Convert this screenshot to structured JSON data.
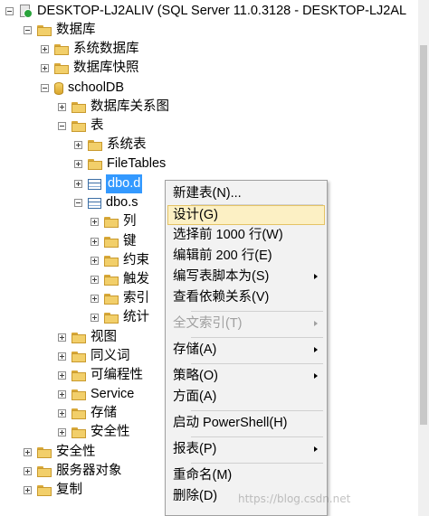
{
  "tree": {
    "server": "DESKTOP-LJ2ALIV (SQL Server 11.0.3128 - DESKTOP-LJ2AL",
    "databases": "数据库",
    "system_databases": "系统数据库",
    "db_snapshots": "数据库快照",
    "schooldb": "schoolDB",
    "db_diagrams": "数据库关系图",
    "tables": "表",
    "system_tables": "系统表",
    "filetables": "FileTables",
    "dbo_table1": "dbo.d",
    "dbo_table2": "dbo.s",
    "columns": "列",
    "keys": "键",
    "constraints": "约束",
    "triggers": "触发",
    "indexes": "索引",
    "statistics": "统计",
    "views": "视图",
    "synonyms": "同义词",
    "programmability": "可编程性",
    "service_broker": "Service",
    "storage": "存储",
    "security_db": "安全性",
    "security": "安全性",
    "server_objects": "服务器对象",
    "replication": "复制"
  },
  "context_menu": {
    "new_table": "新建表(N)...",
    "design": "设计(G)",
    "select_top": "选择前 1000 行(W)",
    "edit_top": "编辑前 200 行(E)",
    "script_table_as": "编写表脚本为(S)",
    "view_dependencies": "查看依赖关系(V)",
    "fulltext_index": "全文索引(T)",
    "storage": "存储(A)",
    "policies": "策略(O)",
    "facets": "方面(A)",
    "start_powershell": "启动 PowerShell(H)",
    "reports": "报表(P)",
    "rename": "重命名(M)",
    "delete": "删除(D)"
  },
  "watermark": "https://blog.csdn.net"
}
